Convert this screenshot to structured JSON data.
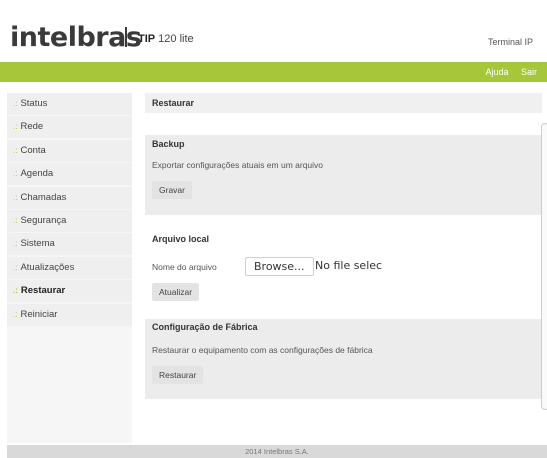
{
  "header": {
    "logo": "intelbras",
    "product_bold": "TIP",
    "product_rest": " 120 lite",
    "terminal_label": "Terminal IP"
  },
  "topnav": {
    "help": "Ajuda",
    "exit": "Sair"
  },
  "sidebar": {
    "items": [
      {
        "label": "Status"
      },
      {
        "label": "Rede"
      },
      {
        "label": "Conta"
      },
      {
        "label": "Agenda"
      },
      {
        "label": "Chamadas"
      },
      {
        "label": "Segurança"
      },
      {
        "label": "Sistema"
      },
      {
        "label": "Atualizações"
      },
      {
        "label": "Restaurar"
      },
      {
        "label": "Reiniciar"
      }
    ],
    "bullet": ".:"
  },
  "main": {
    "title": "Restaurar",
    "backup": {
      "title": "Backup",
      "text": "Exportar configurações atuais em um arquivo",
      "button": "Gravar"
    },
    "local": {
      "title": "Arquivo local",
      "file_label": "Nome do arquivo",
      "browse": "Browse...",
      "status": "No file selec",
      "button": "Atualizar"
    },
    "factory": {
      "title": "Configuração de Fábrica",
      "text": "Restaurar o equipamento com as configurações de fábrica",
      "button": "Restaurar"
    }
  },
  "footer": {
    "text": "2014 Intelbras S.A."
  },
  "colors": {
    "accent": "#a6c739"
  }
}
